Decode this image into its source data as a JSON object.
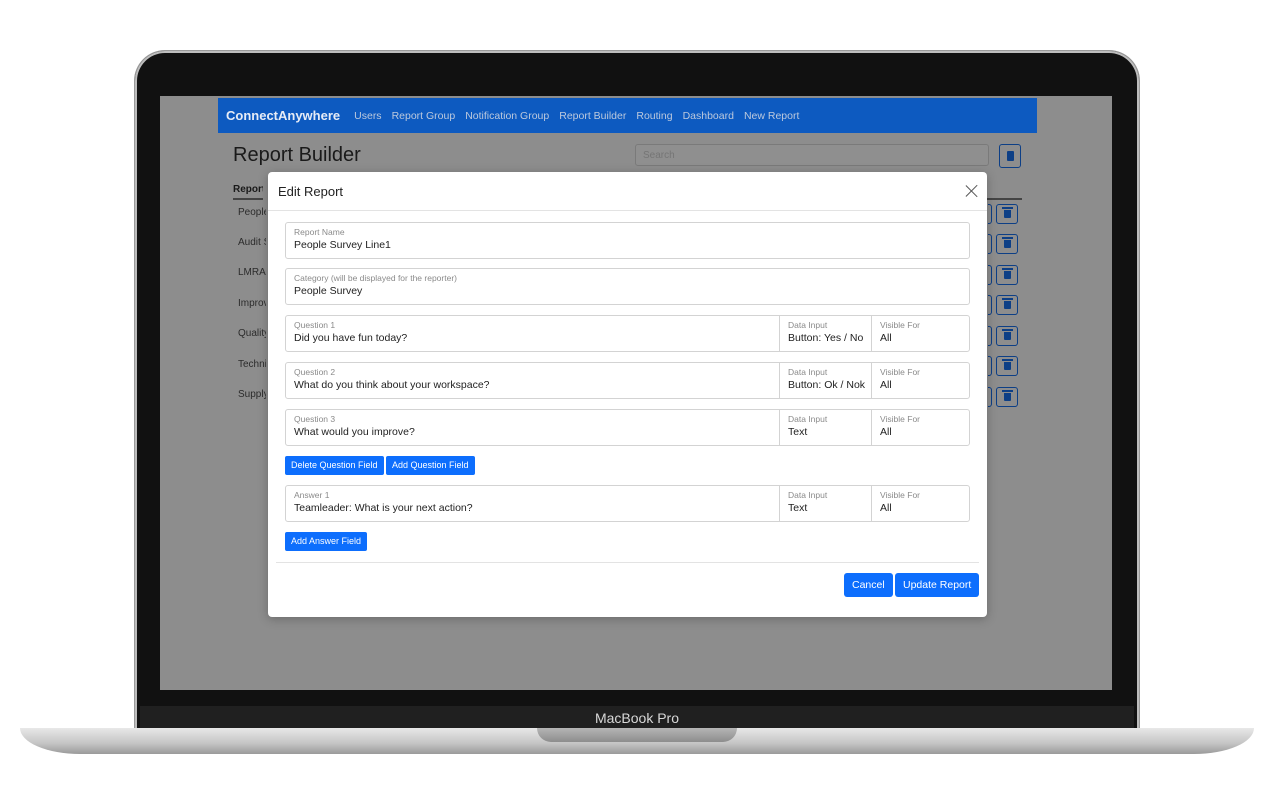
{
  "device": {
    "label": "MacBook Pro"
  },
  "navbar": {
    "brand": "ConnectAnywhere",
    "links": [
      "Users",
      "Report Group",
      "Notification Group",
      "Report Builder",
      "Routing",
      "Dashboard",
      "New Report"
    ]
  },
  "page": {
    "title": "Report Builder",
    "search_placeholder": "Search",
    "table_header": "Report",
    "rows": [
      "People",
      "Audit S",
      "LMRA",
      "Improv",
      "Quality",
      "Techni",
      "Supply"
    ]
  },
  "modal": {
    "title": "Edit Report",
    "report_name": {
      "label": "Report Name",
      "value": "People Survey Line1"
    },
    "category": {
      "label": "Category (will be displayed for the reporter)",
      "value": "People Survey"
    },
    "questions": [
      {
        "label": "Question 1",
        "value": "Did you have fun today?",
        "input_label": "Data Input",
        "input_value": "Button: Yes / No",
        "visible_label": "Visible For",
        "visible_value": "All"
      },
      {
        "label": "Question 2",
        "value": "What do you think about your workspace?",
        "input_label": "Data Input",
        "input_value": "Button: Ok / Nok",
        "visible_label": "Visible For",
        "visible_value": "All"
      },
      {
        "label": "Question 3",
        "value": "What would you improve?",
        "input_label": "Data Input",
        "input_value": "Text",
        "visible_label": "Visible For",
        "visible_value": "All"
      }
    ],
    "delete_question_label": "Delete Question Field",
    "add_question_label": "Add Question Field",
    "answers": [
      {
        "label": "Answer 1",
        "value": "Teamleader: What is your next action?",
        "input_label": "Data Input",
        "input_value": "Text",
        "visible_label": "Visible For",
        "visible_value": "All"
      }
    ],
    "add_answer_label": "Add Answer Field",
    "cancel_label": "Cancel",
    "update_label": "Update Report"
  },
  "colors": {
    "primary": "#0d6efd",
    "navbar": "#0d5ac0"
  }
}
